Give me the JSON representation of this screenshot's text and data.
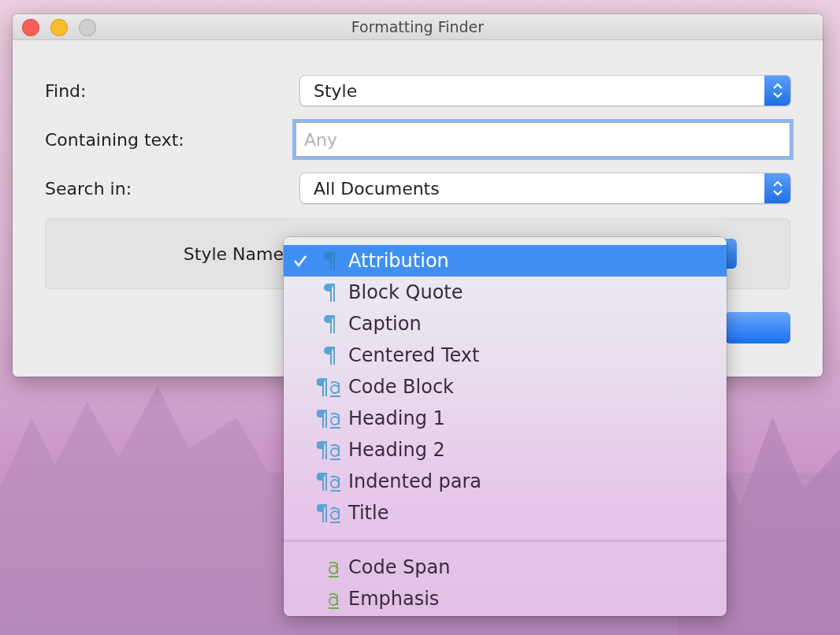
{
  "window": {
    "title": "Formatting Finder"
  },
  "form": [
    {
      "kind": "popup",
      "label": "Find:",
      "value": "Style"
    },
    {
      "kind": "text",
      "label": "Containing text:",
      "placeholder": "Any",
      "focused": true
    },
    {
      "kind": "popup",
      "label": "Search in:",
      "value": "All Documents"
    }
  ],
  "style_name": {
    "label": "Style Name"
  },
  "menu": {
    "groups": [
      [
        {
          "label": "Attribution",
          "kind": "paragraph",
          "selected": true
        },
        {
          "label": "Block Quote",
          "kind": "paragraph",
          "selected": false
        },
        {
          "label": "Caption",
          "kind": "paragraph",
          "selected": false
        },
        {
          "label": "Centered Text",
          "kind": "paragraph",
          "selected": false
        },
        {
          "label": "Code Block",
          "kind": "linked",
          "selected": false
        },
        {
          "label": "Heading 1",
          "kind": "linked",
          "selected": false
        },
        {
          "label": "Heading 2",
          "kind": "linked",
          "selected": false
        },
        {
          "label": "Indented para",
          "kind": "linked",
          "selected": false
        },
        {
          "label": "Title",
          "kind": "linked",
          "selected": false
        }
      ],
      [
        {
          "label": "Code Span",
          "kind": "character",
          "selected": false
        },
        {
          "label": "Emphasis",
          "kind": "character",
          "selected": false
        }
      ]
    ]
  }
}
